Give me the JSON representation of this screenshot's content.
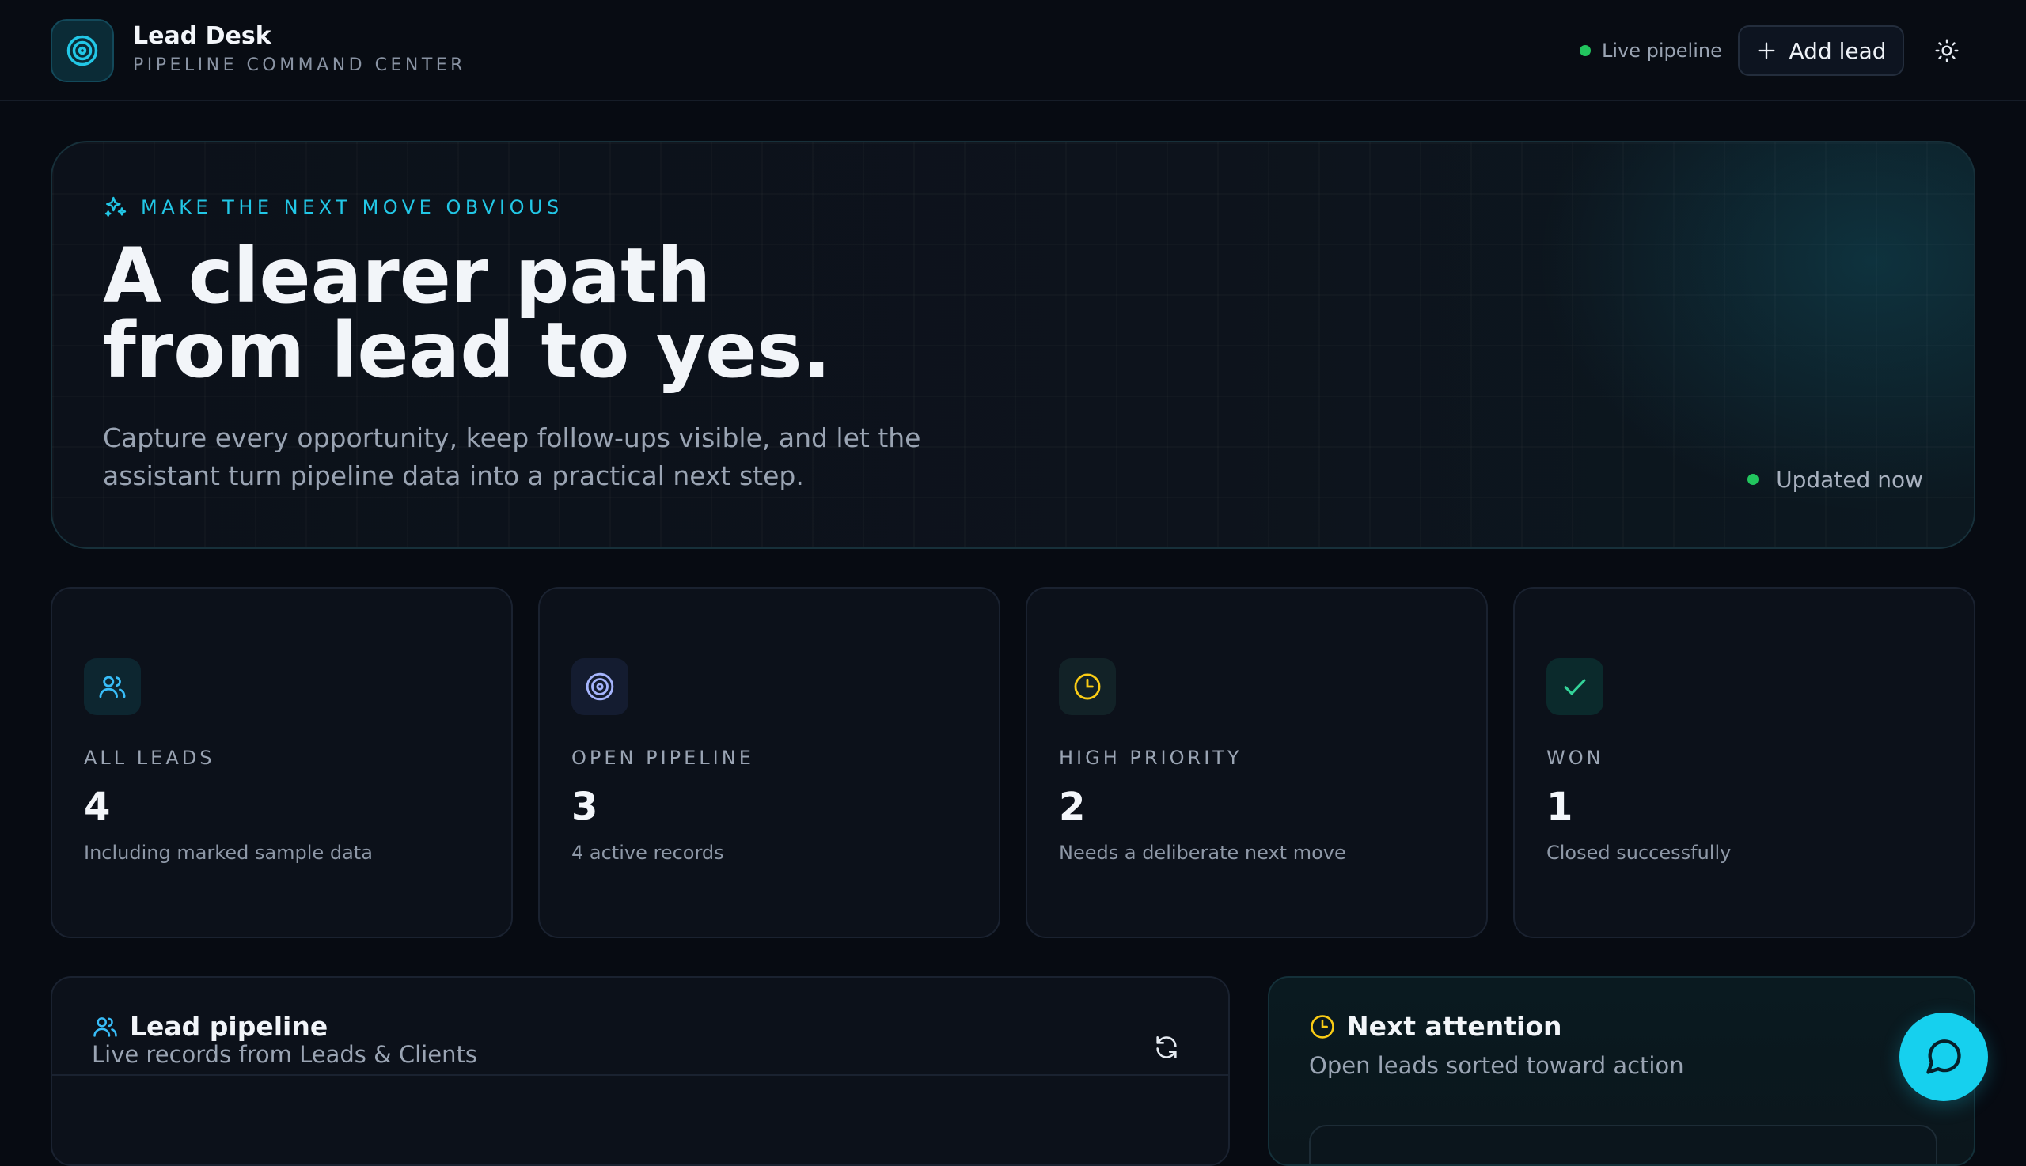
{
  "header": {
    "brand_name": "Lead Desk",
    "brand_subtitle": "PIPELINE COMMAND CENTER",
    "live_status": "Live pipeline",
    "add_button_label": "Add lead",
    "logo_icon": "target-icon",
    "theme_icon": "sun-icon"
  },
  "hero": {
    "eyebrow": "MAKE THE NEXT MOVE OBVIOUS",
    "title_line1": "A clearer path",
    "title_line2": "from lead to yes.",
    "subtitle": "Capture every opportunity, keep follow-ups visible, and let the assistant turn pipeline data into a practical next step.",
    "updated": "Updated now"
  },
  "stats": [
    {
      "icon": "users-icon",
      "label": "ALL LEADS",
      "value": "4",
      "note": "Including marked sample data"
    },
    {
      "icon": "target-icon",
      "label": "OPEN PIPELINE",
      "value": "3",
      "note": "4 active records"
    },
    {
      "icon": "clock-icon",
      "label": "HIGH PRIORITY",
      "value": "2",
      "note": "Needs a deliberate next move"
    },
    {
      "icon": "check-icon",
      "label": "WON",
      "value": "1",
      "note": "Closed successfully"
    }
  ],
  "pipeline_panel": {
    "title": "Lead pipeline",
    "subtitle": "Live records from Leads & Clients"
  },
  "attention_panel": {
    "title": "Next attention",
    "subtitle": "Open leads sorted toward action"
  },
  "colors": {
    "accent": "#22c7e6",
    "live": "#22c55e",
    "priority": "#facc15",
    "background": "#070b12"
  }
}
